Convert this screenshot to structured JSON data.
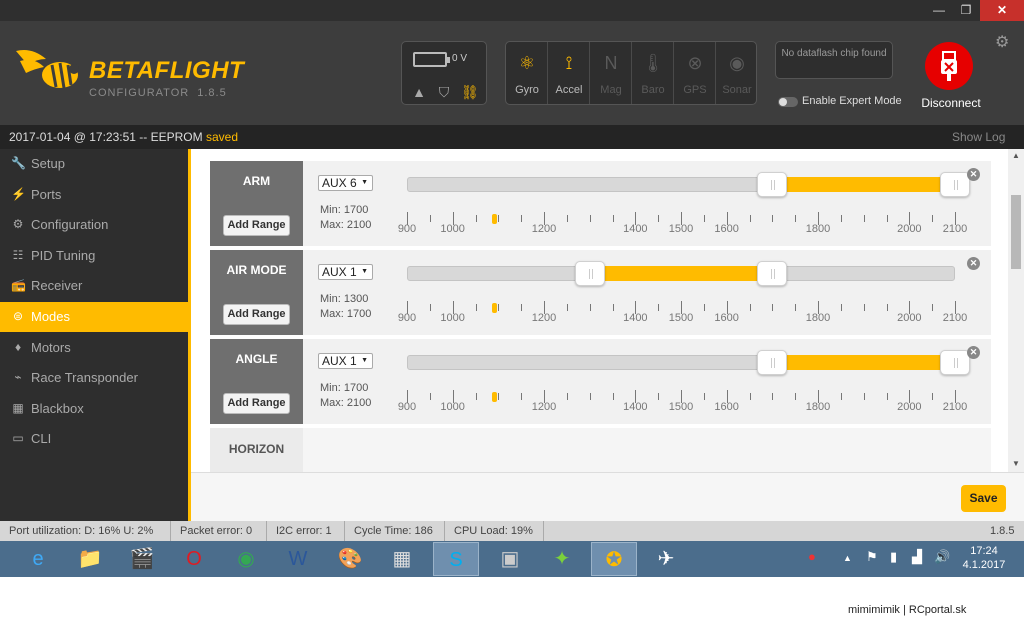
{
  "window": {
    "minimize": "—",
    "maximize": "❐",
    "close": "✕"
  },
  "header": {
    "brand": "BETAFLIGHT",
    "subtitle": "CONFIGURATOR",
    "version": "1.8.5",
    "battery_voltage": "0 V",
    "sensors": [
      {
        "label": "Gyro",
        "icon": "gyro-icon",
        "active": true
      },
      {
        "label": "Accel",
        "icon": "accel-icon",
        "active": true
      },
      {
        "label": "Mag",
        "icon": "mag-icon",
        "active": false
      },
      {
        "label": "Baro",
        "icon": "baro-icon",
        "active": false
      },
      {
        "label": "GPS",
        "icon": "gps-icon",
        "active": false
      },
      {
        "label": "Sonar",
        "icon": "sonar-icon",
        "active": false
      }
    ],
    "dataflash": "No dataflash chip found",
    "expert_mode": "Enable Expert Mode",
    "disconnect": "Disconnect"
  },
  "status": {
    "text": "2017-01-04 @ 17:23:51 -- EEPROM",
    "saved": "saved",
    "show_log": "Show Log"
  },
  "sidebar": {
    "items": [
      {
        "label": "Setup",
        "icon": "wrench-icon",
        "glyph": "🔧"
      },
      {
        "label": "Ports",
        "icon": "plug-icon",
        "glyph": "⚡"
      },
      {
        "label": "Configuration",
        "icon": "gear-icon",
        "glyph": "⚙"
      },
      {
        "label": "PID Tuning",
        "icon": "sliders-icon",
        "glyph": "☷"
      },
      {
        "label": "Receiver",
        "icon": "receiver-icon",
        "glyph": "📻"
      },
      {
        "label": "Modes",
        "icon": "toggle-icon",
        "glyph": "⊜"
      },
      {
        "label": "Motors",
        "icon": "motor-icon",
        "glyph": "♦"
      },
      {
        "label": "Race Transponder",
        "icon": "transponder-icon",
        "glyph": "⌁"
      },
      {
        "label": "Blackbox",
        "icon": "blackbox-icon",
        "glyph": "▦"
      },
      {
        "label": "CLI",
        "icon": "terminal-icon",
        "glyph": "▭"
      }
    ],
    "active": "Modes"
  },
  "modes": {
    "scale": {
      "min": 900,
      "max": 2100,
      "labels": [
        "900",
        "1000",
        "1200",
        "1400",
        "1500",
        "1600",
        "1800",
        "2000",
        "2100"
      ]
    },
    "items": [
      {
        "name": "ARM",
        "channel": "AUX 6",
        "min_label": "Min: 1700",
        "max_label": "Max: 2100",
        "range_min": 1700,
        "range_max": 2100,
        "current": 1090,
        "add_range": "Add Range",
        "remove": "✕"
      },
      {
        "name": "AIR MODE",
        "channel": "AUX 1",
        "min_label": "Min: 1300",
        "max_label": "Max: 1700",
        "range_min": 1300,
        "range_max": 1700,
        "current": 1090,
        "add_range": "Add Range",
        "remove": "✕"
      },
      {
        "name": "ANGLE",
        "channel": "AUX 1",
        "min_label": "Min: 1700",
        "max_label": "Max: 2100",
        "range_min": 1700,
        "range_max": 2100,
        "current": 1090,
        "add_range": "Add Range",
        "remove": "✕"
      }
    ],
    "partial": {
      "name": "HORIZON"
    }
  },
  "footer": {
    "save": "Save"
  },
  "infobar": {
    "port_util": "Port utilization: D: 16% U: 2%",
    "packet_error": "Packet error: 0",
    "i2c_error": "I2C error: 1",
    "cycle_time": "Cycle Time: 186",
    "cpu_load": "CPU Load: 19%",
    "version": "1.8.5"
  },
  "taskbar": {
    "apps": [
      {
        "icon": "ie-icon",
        "glyph": "e",
        "color": "#3fa9f5",
        "active": false
      },
      {
        "icon": "explorer-icon",
        "glyph": "📁",
        "color": "#f5d36b",
        "active": false
      },
      {
        "icon": "media-icon",
        "glyph": "🎬",
        "color": "#aaa",
        "active": false
      },
      {
        "icon": "opera-icon",
        "glyph": "O",
        "color": "#e01b22",
        "active": false
      },
      {
        "icon": "chrome-icon",
        "glyph": "◉",
        "color": "#34a853",
        "active": false
      },
      {
        "icon": "word-icon",
        "glyph": "W",
        "color": "#2b579a",
        "active": false
      },
      {
        "icon": "paint-icon",
        "glyph": "🎨",
        "color": "#ffcc66",
        "active": false
      },
      {
        "icon": "calculator-icon",
        "glyph": "▦",
        "color": "#ddd",
        "active": false
      },
      {
        "icon": "skype-icon",
        "glyph": "S",
        "color": "#00aff0",
        "active": true
      },
      {
        "icon": "app-icon",
        "glyph": "▣",
        "color": "#ccc",
        "active": false
      },
      {
        "icon": "cleanflight-icon",
        "glyph": "✦",
        "color": "#7bd13b",
        "active": false
      },
      {
        "icon": "betaflight-icon",
        "glyph": "✪",
        "color": "#ffbb00",
        "active": true
      },
      {
        "icon": "openpilot-icon",
        "glyph": "✈",
        "color": "#fff",
        "active": false
      }
    ],
    "time": "17:24",
    "date": "4.1.2017"
  },
  "watermark": "mimimimik | RCportal.sk"
}
